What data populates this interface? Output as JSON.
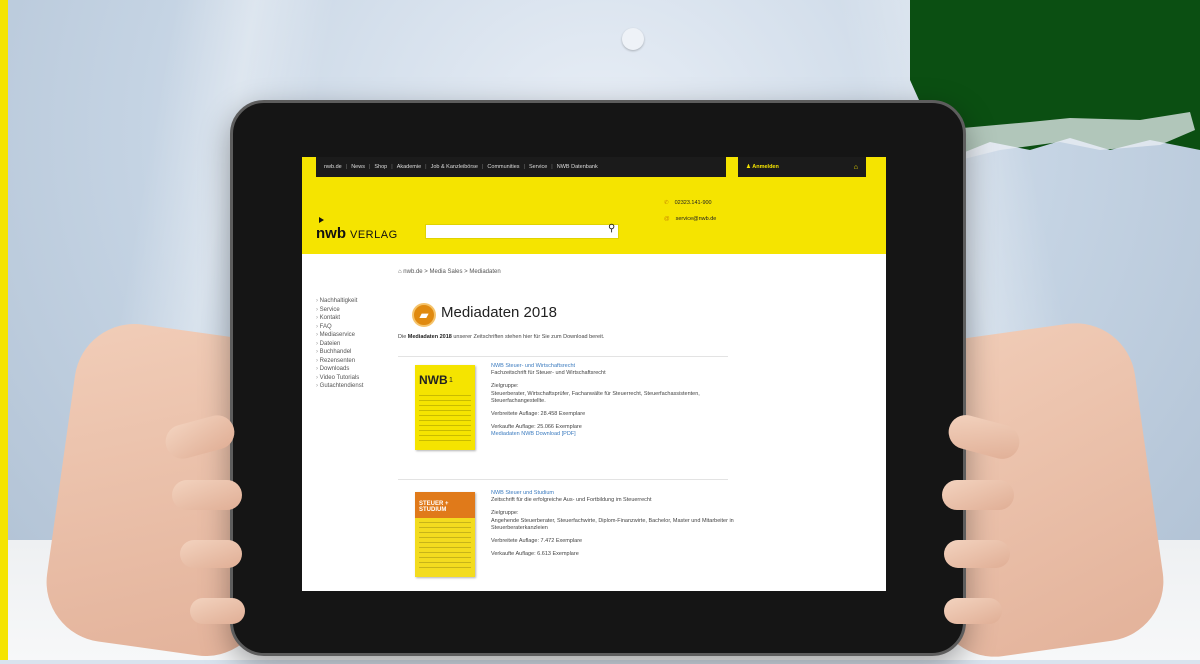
{
  "topnav": {
    "items": [
      "nwb.de",
      "News",
      "Shop",
      "Akademie",
      "Job & Kanzleibörse",
      "Communities",
      "Service",
      "NWB Datenbank"
    ]
  },
  "login": {
    "label": "Anmelden",
    "cart_icon": "lock-icon"
  },
  "brand": {
    "logo_main": "nwb",
    "logo_sub": "VERLAG",
    "yellow": "#f5e400"
  },
  "contact": {
    "phone": "02323.141-900",
    "email": "service@nwb.de"
  },
  "breadcrumb": "nwb.de > Media Sales > Mediadaten",
  "sidebar": {
    "items": [
      "Nachhaltigkeit",
      "Service",
      "Kontakt",
      "FAQ",
      "Mediaservice",
      "Dateien",
      "Buchhandel",
      "Rezensenten",
      "Downloads",
      "Video Tutorials",
      "Gutachtendienst"
    ]
  },
  "page": {
    "title": "Mediadaten 2018",
    "intro_prefix": "Die",
    "intro_bold": "Mediadaten 2018",
    "intro_suffix": "unserer Zeitschriften stehen hier für Sie zum Download bereit."
  },
  "entries": [
    {
      "cover_title": "NWB",
      "cover_number": "1",
      "name": "NWB Steuer- und Wirtschaftsrecht",
      "desc": "Fachzeitschrift für Steuer- und Wirtschaftsrecht",
      "target_label": "Zielgruppe:",
      "target": "Steuerberater, Wirtschaftsprüfer, Fachanwälte für Steuerrecht, Steuerfachassistenten, Steuerfachangestellte.",
      "distributed": "Verbreitete Auflage: 28.458 Exemplare",
      "sold": "Verkaufte Auflage: 25.066 Exemplare",
      "download": "Mediadaten NWB Download [PDF]"
    },
    {
      "cover_title": "STEUER + STUDIUM",
      "name": "NWB Steuer und Studium",
      "desc": "Zeitschrift für die erfolgreiche Aus- und Fortbildung im Steuerrecht",
      "target_label": "Zielgruppe:",
      "target": "Angehende Steuerberater, Steuerfachwirte, Diplom-Finanzwirte, Bachelor, Master und Mitarbeiter in Steuerberaterkanzleien",
      "distributed": "Verbreitete Auflage: 7.472 Exemplare",
      "sold": "Verkaufte Auflage: 6.613 Exemplare"
    }
  ]
}
